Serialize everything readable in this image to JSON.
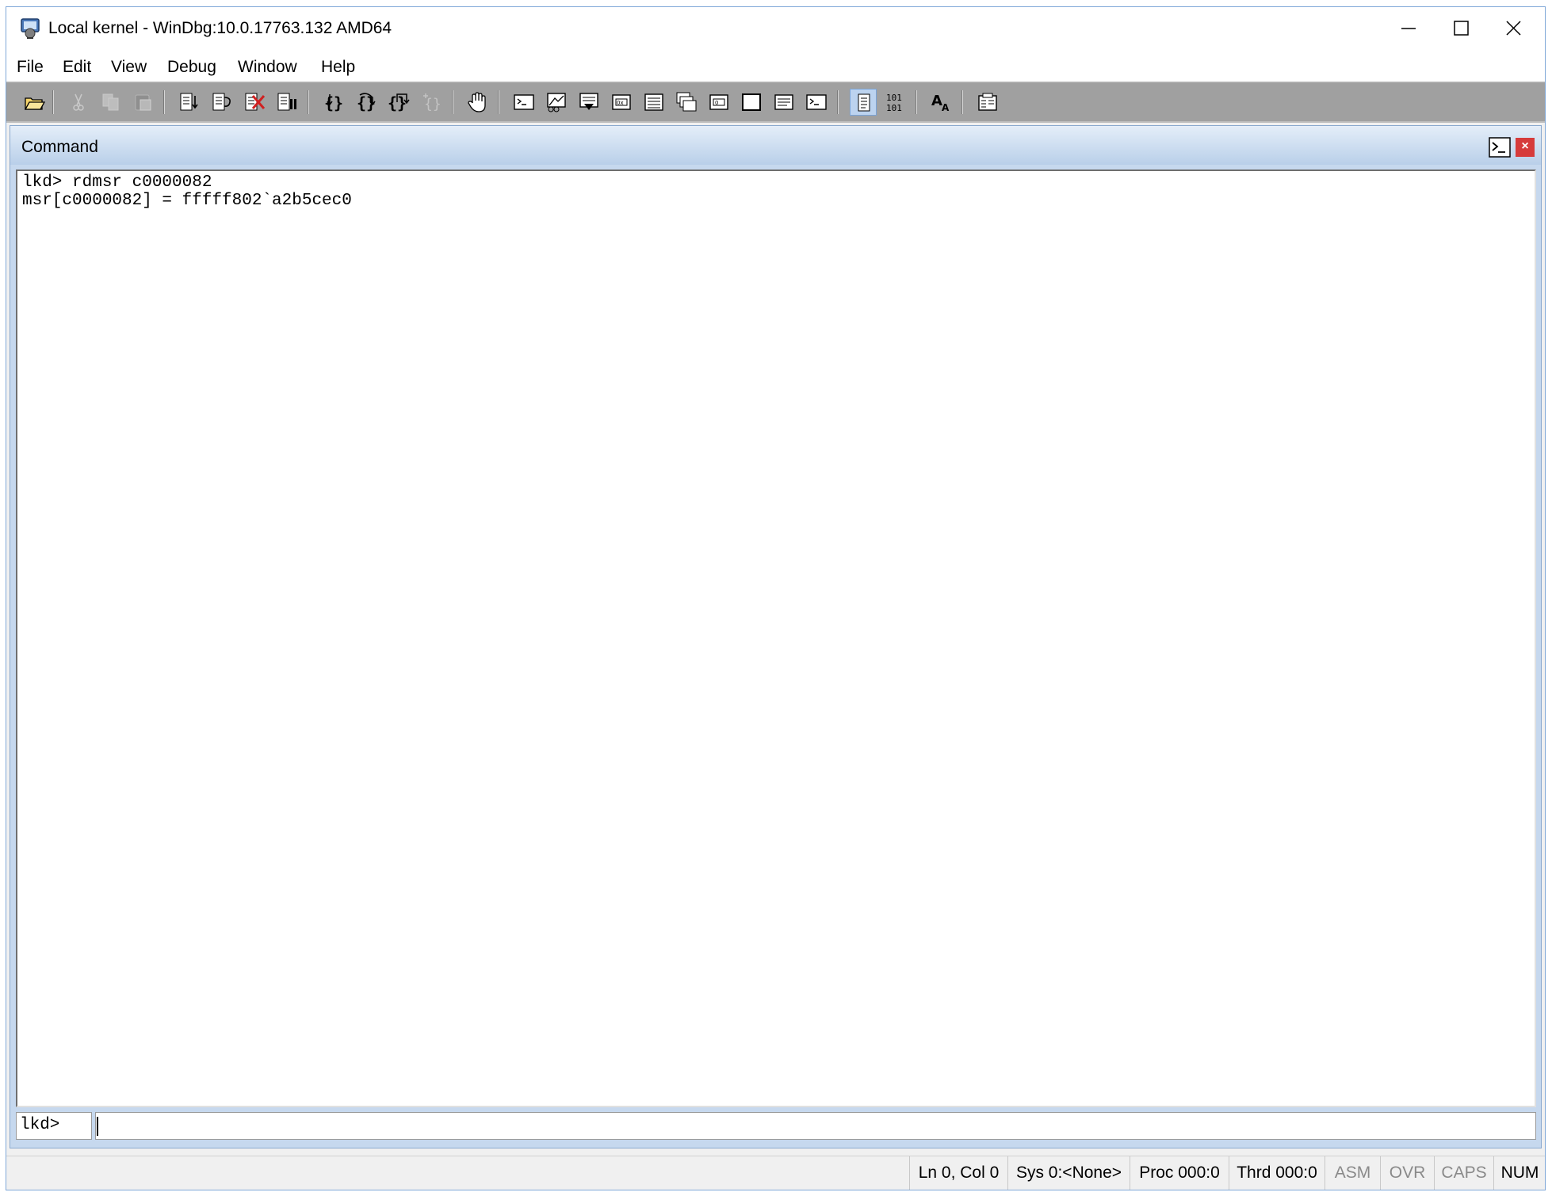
{
  "window": {
    "title": "Local kernel - WinDbg:10.0.17763.132 AMD64",
    "controls": [
      "minimize-icon",
      "maximize-icon",
      "close-icon"
    ]
  },
  "menu": {
    "file": "File",
    "edit": "Edit",
    "view": "View",
    "debug": "Debug",
    "window": "Window",
    "help": "Help"
  },
  "toolbar": {
    "icons": [
      "open-folder-icon",
      "cut-icon",
      "copy-icon",
      "paste-icon",
      "go-icon",
      "restart-icon",
      "stop-debugging-icon",
      "break-icon",
      "step-into-icon",
      "step-over-icon",
      "step-out-icon",
      "run-to-cursor-icon",
      "hand-icon",
      "command-window-icon",
      "watch-window-icon",
      "locals-window-icon",
      "registers-window-icon",
      "memory-window-icon",
      "call-stack-window-icon",
      "disassembly-window-icon",
      "scratch-pad-icon",
      "processes-threads-icon",
      "command-browser-icon",
      "source-mode-icon",
      "binary-101-icon",
      "font-icon",
      "options-icon"
    ],
    "source_mode_pressed": true,
    "binary_label_top": "101",
    "binary_label_bottom": "101",
    "font_label_big": "A",
    "font_label_small": "A"
  },
  "command": {
    "title": "Command",
    "output_lines": [
      "lkd> rdmsr c0000082",
      "msr[c0000082] = fffff802`a2b5cec0"
    ],
    "prompt": "lkd>",
    "input_value": ""
  },
  "status": {
    "ln_col": "Ln 0, Col 0",
    "sys": "Sys 0:<None>",
    "proc": "Proc 000:0",
    "thrd": "Thrd 000:0",
    "asm": "ASM",
    "ovr": "OVR",
    "caps": "CAPS",
    "num": "NUM"
  },
  "colors": {
    "toolbar_bg": "#a0a0a0",
    "panel_header": "#b9cfe9",
    "close_red": "#d63b3b",
    "window_border": "#7fa8d8"
  }
}
